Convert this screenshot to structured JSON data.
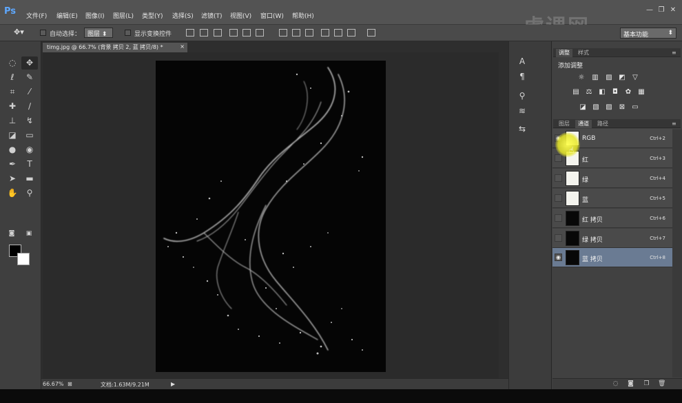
{
  "app": {
    "logo": "Ps"
  },
  "menu": [
    "文件(F)",
    "编辑(E)",
    "图像(I)",
    "图层(L)",
    "类型(Y)",
    "选择(S)",
    "滤镜(T)",
    "视图(V)",
    "窗口(W)",
    "帮助(H)"
  ],
  "window_controls": {
    "minimize": "—",
    "restore": "❐",
    "close": "✕"
  },
  "watermark": "虎课网",
  "options": {
    "auto_select_label": "自动选择：",
    "auto_select_value": "图层",
    "show_transform_label": "显示变换控件",
    "workspace": "基本功能"
  },
  "document": {
    "tab_title": "timg.jpg @ 66.7% (背景 拷贝 2, 蓝 拷贝/8) *",
    "tab_close": "×",
    "zoom": "66.67%",
    "doc_info": "文档:1.63M/9.21M"
  },
  "adjustments": {
    "tabs": [
      "调整",
      "样式"
    ],
    "title": "添加调整"
  },
  "layers_panel": {
    "tabs": [
      "图层",
      "通道",
      "路径"
    ]
  },
  "channels": [
    {
      "name": "RGB",
      "shortcut": "Ctrl+2",
      "visible": true,
      "selected": false,
      "thumb": "light"
    },
    {
      "name": "红",
      "shortcut": "Ctrl+3",
      "visible": true,
      "selected": false,
      "thumb": "light"
    },
    {
      "name": "绿",
      "shortcut": "Ctrl+4",
      "visible": true,
      "selected": false,
      "thumb": "light"
    },
    {
      "name": "蓝",
      "shortcut": "Ctrl+5",
      "visible": true,
      "selected": false,
      "thumb": "light"
    },
    {
      "name": "红 拷贝",
      "shortcut": "Ctrl+6",
      "visible": false,
      "selected": false,
      "thumb": "dark"
    },
    {
      "name": "绿 拷贝",
      "shortcut": "Ctrl+7",
      "visible": false,
      "selected": false,
      "thumb": "dark"
    },
    {
      "name": "蓝 拷贝",
      "shortcut": "Ctrl+8",
      "visible": true,
      "selected": true,
      "thumb": "dark"
    }
  ],
  "colors": {
    "foreground": "#000000",
    "background": "#ffffff",
    "selection": "#6a7b93",
    "highlight": "#f0f040"
  }
}
